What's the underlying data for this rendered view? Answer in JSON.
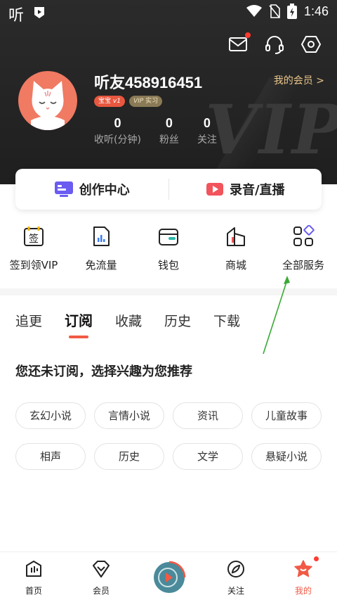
{
  "status_bar": {
    "app_glyph": "听",
    "time": "1:46"
  },
  "header": {
    "username": "听友458916451",
    "badge_baby": "宝宝",
    "badge_baby_level": "v1",
    "badge_vip": "VIP",
    "badge_vip_sub": "实习",
    "member_link": "我的会员 >",
    "watermark": "VIP",
    "stats": [
      {
        "value": "0",
        "label": "收听(分钟)"
      },
      {
        "value": "0",
        "label": "粉丝"
      },
      {
        "value": "0",
        "label": "关注"
      }
    ]
  },
  "create_card": {
    "left_label": "创作中心",
    "right_label": "录音/直播"
  },
  "services": [
    {
      "label": "签到领VIP",
      "icon": "sign-in-icon",
      "glyph": "签"
    },
    {
      "label": "免流量",
      "icon": "free-data-icon"
    },
    {
      "label": "钱包",
      "icon": "wallet-icon"
    },
    {
      "label": "商城",
      "icon": "shop-icon"
    },
    {
      "label": "全部服务",
      "icon": "all-services-icon"
    }
  ],
  "tabs": [
    {
      "label": "追更",
      "active": false
    },
    {
      "label": "订阅",
      "active": true
    },
    {
      "label": "收藏",
      "active": false
    },
    {
      "label": "历史",
      "active": false
    },
    {
      "label": "下载",
      "active": false
    }
  ],
  "recommend": {
    "title": "您还未订阅，选择兴趣为您推荐",
    "chips": [
      "玄幻小说",
      "言情小说",
      "资讯",
      "儿童故事",
      "相声",
      "历史",
      "文学",
      "悬疑小说"
    ]
  },
  "bottom_nav": [
    {
      "label": "首页",
      "icon": "home-icon",
      "active": false
    },
    {
      "label": "会员",
      "icon": "vip-icon",
      "active": false
    },
    {
      "label": "",
      "icon": "player-icon",
      "active": false
    },
    {
      "label": "关注",
      "icon": "follow-icon",
      "active": false
    },
    {
      "label": "我的",
      "icon": "mine-icon",
      "active": true
    }
  ],
  "colors": {
    "accent": "#f15a45",
    "header_bg": "#232323",
    "member_gold": "#e9c58a",
    "annotation_arrow": "#3aaa35"
  }
}
